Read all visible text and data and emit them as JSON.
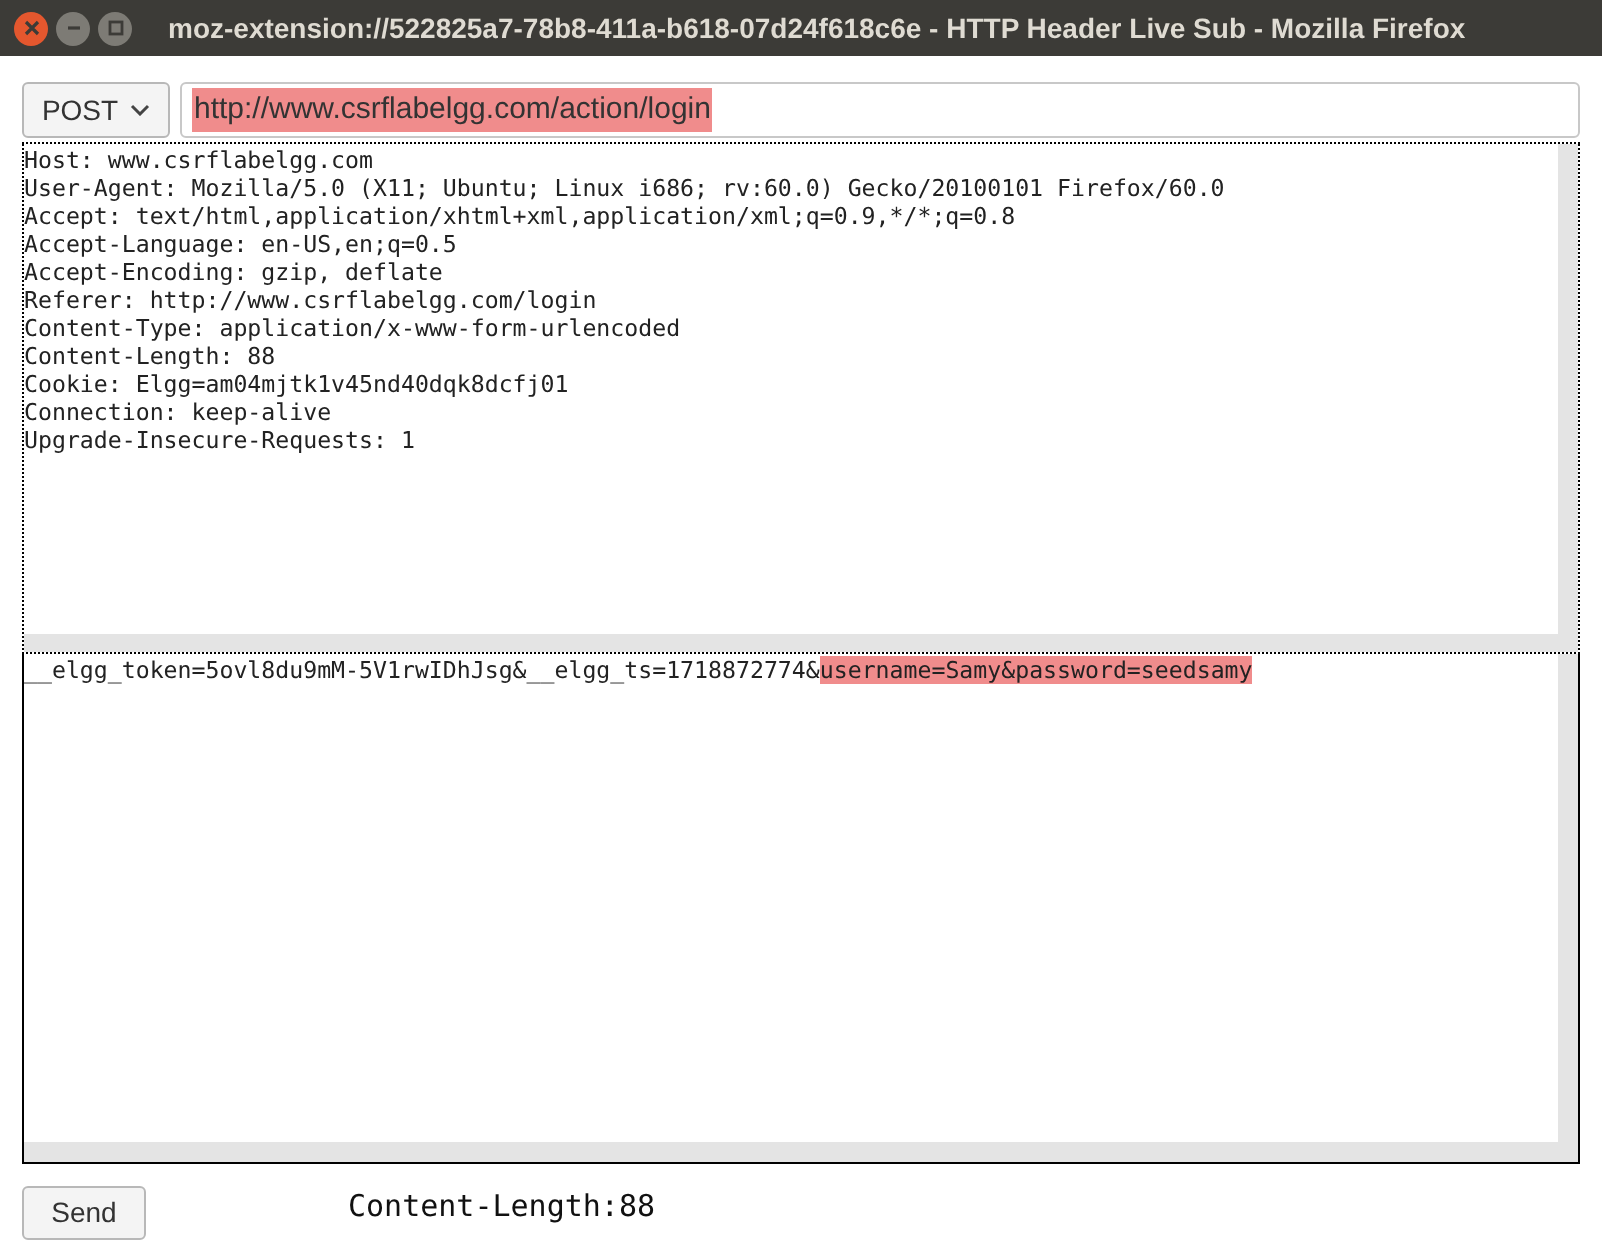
{
  "window": {
    "title": "moz-extension://522825a7-78b8-411a-b618-07d24f618c6e - HTTP Header Live Sub - Mozilla Firefox"
  },
  "method": {
    "value": "POST"
  },
  "url": {
    "value": "http://www.csrflabelgg.com/action/login",
    "highlighted": true
  },
  "headers": [
    "Host: www.csrflabelgg.com",
    "User-Agent: Mozilla/5.0 (X11; Ubuntu; Linux i686; rv:60.0) Gecko/20100101 Firefox/60.0",
    "Accept: text/html,application/xhtml+xml,application/xml;q=0.9,*/*;q=0.8",
    "Accept-Language: en-US,en;q=0.5",
    "Accept-Encoding: gzip, deflate",
    "Referer: http://www.csrflabelgg.com/login",
    "Content-Type: application/x-www-form-urlencoded",
    "Content-Length: 88",
    "Cookie: Elgg=am04mjtk1v45nd40dqk8dcfj01",
    "Connection: keep-alive",
    "Upgrade-Insecure-Requests: 1"
  ],
  "body": [
    {
      "text": "__elgg_token=5ovl8du9mM-5V1rwIDhJsg&__elgg_ts=1718872774&",
      "highlighted": false
    },
    {
      "text": "username=Samy&password=seedsamy",
      "highlighted": true
    }
  ],
  "send_button": "Send",
  "content_length": "Content-Length:88"
}
